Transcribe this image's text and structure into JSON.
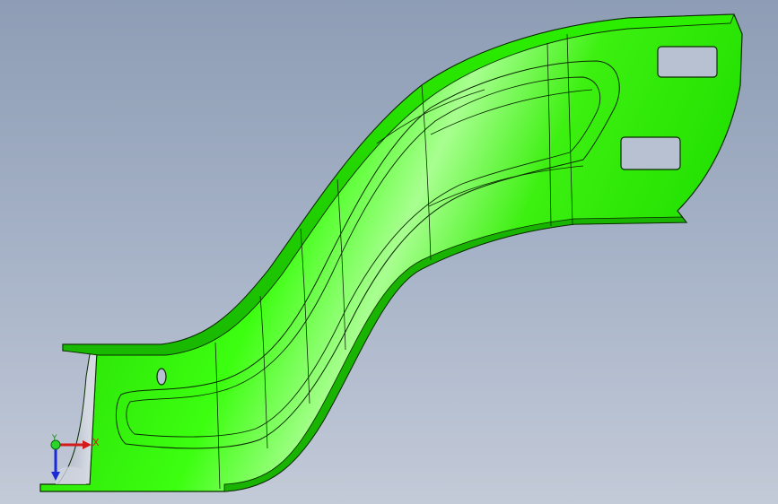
{
  "viewport": {
    "background_top": "#8e9db5",
    "background_bottom": "#c3cad8"
  },
  "model": {
    "part_color": "#22e000",
    "part_highlight": "#8cff6a",
    "part_shadow": "#14a800",
    "edge_color": "#0a2a00",
    "cutout_color": "#b7c1d1"
  },
  "triad": {
    "x_label": "X",
    "y_label": "Y",
    "x_color": "#d41a1a",
    "y_color": "#1a8a1a",
    "z_color": "#1a2ad4"
  }
}
